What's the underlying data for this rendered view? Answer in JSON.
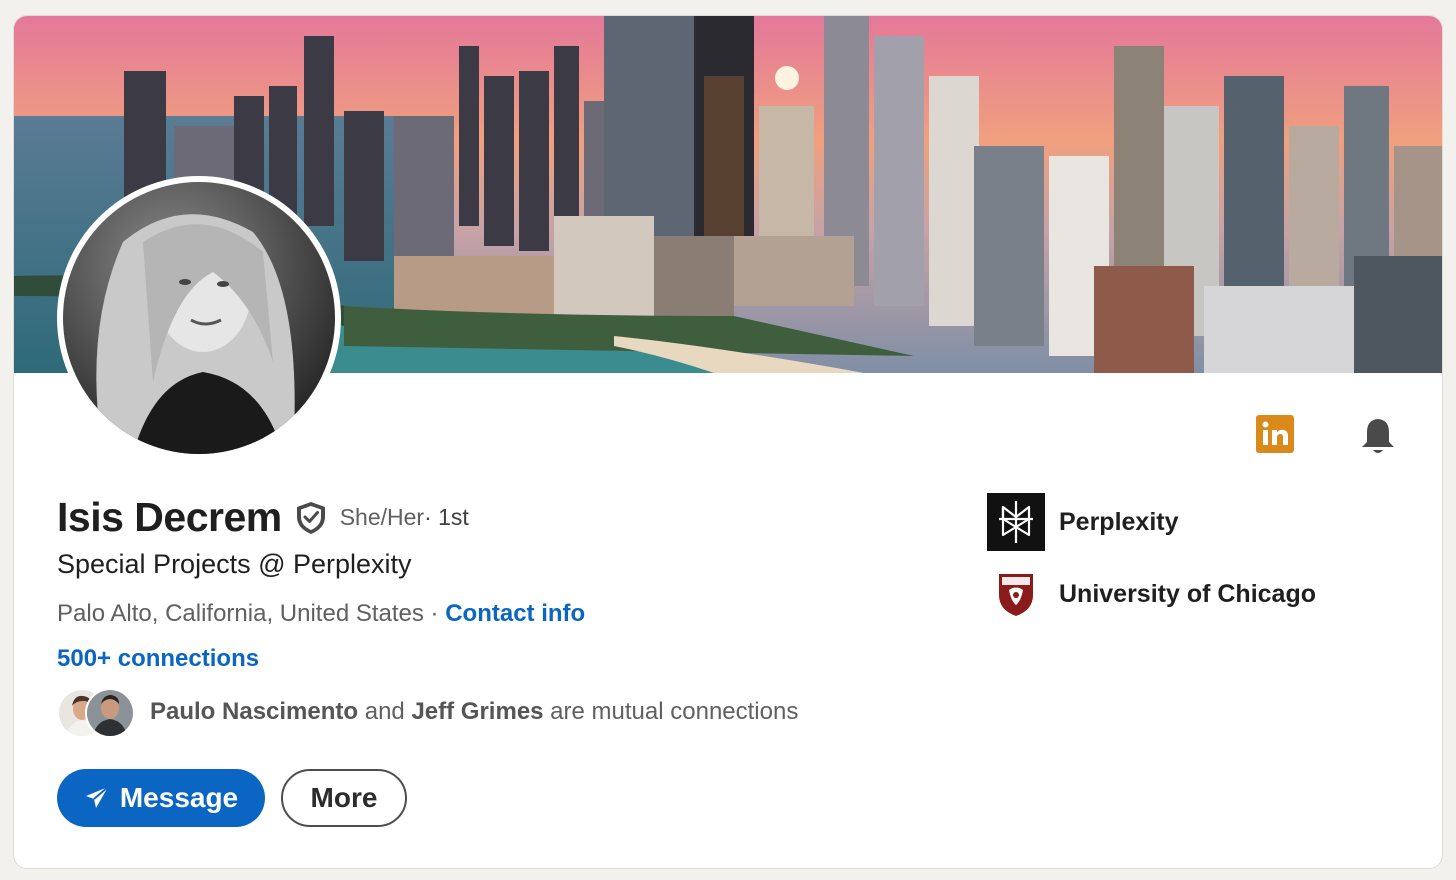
{
  "profile": {
    "name": "Isis Decrem",
    "pronouns": "She/Her",
    "degree": " · 1st",
    "headline": "Special Projects @ Perplexity",
    "location": "Palo Alto, California, United States",
    "location_separator": " · ",
    "contact_info": "Contact info",
    "connections": "500+ connections"
  },
  "mutual": {
    "first": "Paulo Nascimento",
    "joiner": " and ",
    "second": "Jeff Grimes",
    "suffix": " are mutual connections"
  },
  "actions": {
    "message_label": "Message",
    "more_label": "More"
  },
  "orgs": [
    {
      "name": "Perplexity",
      "logo": "perplexity-logo"
    },
    {
      "name": "University of Chicago",
      "logo": "uchicago-crest"
    }
  ],
  "icons": {
    "top_right": [
      "linkedin-icon",
      "bell-icon"
    ],
    "name": "verified-shield-icon",
    "message": "paper-plane-icon"
  },
  "colors": {
    "link_blue": "#0a66c2",
    "linkedin_badge": "#d98a1a",
    "card_bg": "#ffffff",
    "page_bg": "#f3f1ed"
  }
}
